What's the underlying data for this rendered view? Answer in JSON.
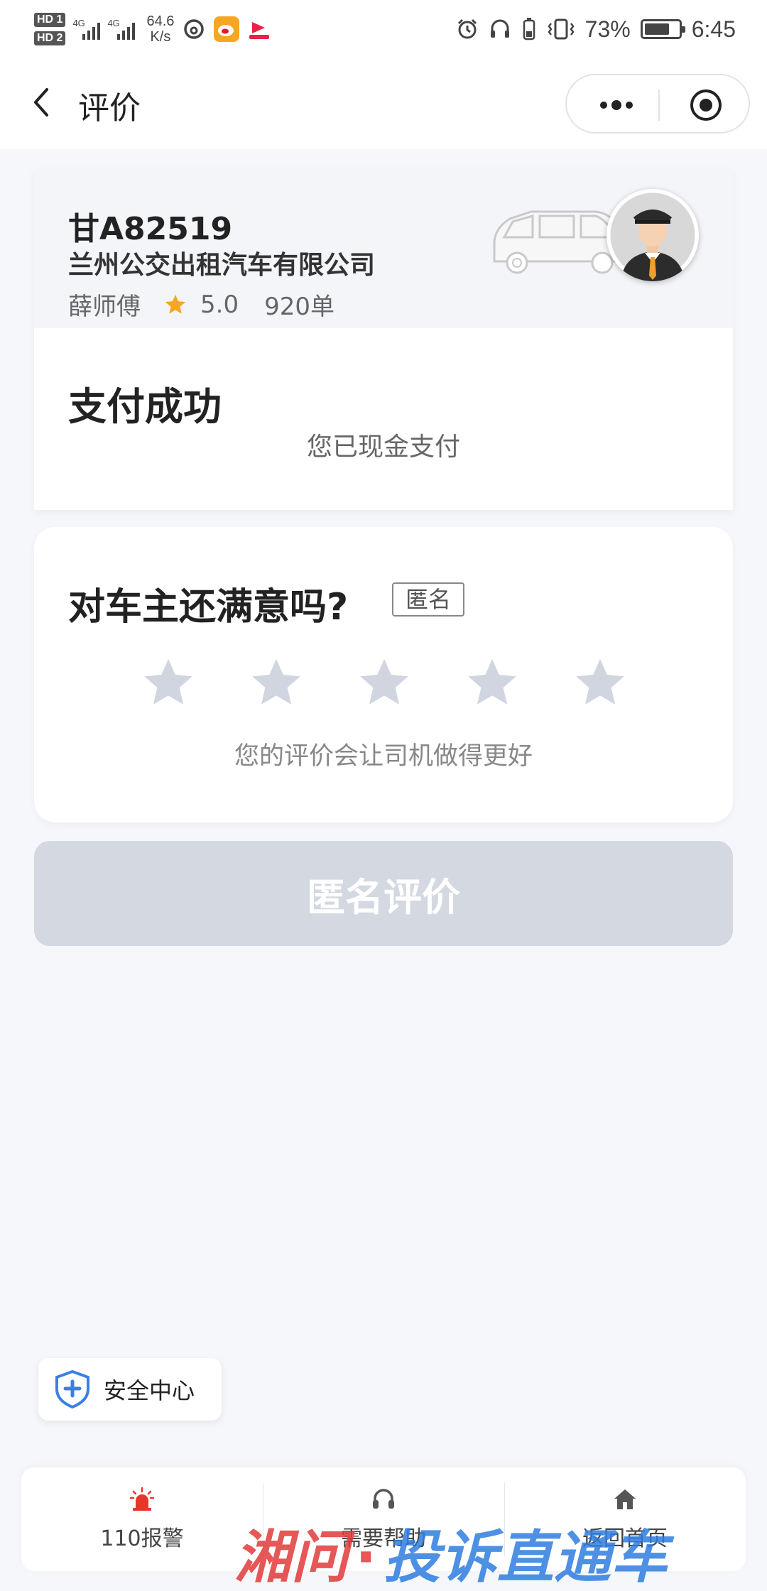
{
  "status_bar": {
    "hd_badges": [
      "HD 1",
      "HD 2"
    ],
    "network_1": "4G",
    "network_2": "4G",
    "speed_value": "64.6",
    "speed_unit": "K/s",
    "battery_text": "73%",
    "battery_level": 0.73,
    "time": "6:45"
  },
  "header": {
    "title": "评价"
  },
  "trip": {
    "plate": "甘A82519",
    "company": "兰州公交出租汽车有限公司",
    "driver_name": "薛师傅",
    "rating": "5.0",
    "orders": "920单",
    "payment_title": "支付成功",
    "payment_desc": "您已现金支付"
  },
  "rating": {
    "question": "对车主还满意吗?",
    "anonymous_tag": "匿名",
    "stars_total": 5,
    "stars_selected": 0,
    "hint": "您的评价会让司机做得更好"
  },
  "submit": {
    "label": "匿名评价"
  },
  "safety": {
    "label": "安全中心"
  },
  "bottom_actions": [
    {
      "label": "110报警",
      "icon": "alarm-icon"
    },
    {
      "label": "需要帮助",
      "icon": "headset-icon"
    },
    {
      "label": "返回首页",
      "icon": "home-icon"
    }
  ],
  "watermark": {
    "text": "湘问·投诉直通车"
  },
  "colors": {
    "star_filled": "#f5a623",
    "star_empty": "#d0d5df",
    "button_disabled": "#d3d8e1",
    "alarm_red": "#e8352b",
    "shield_blue": "#3b7fe6",
    "watermark_red": "#e23a3a",
    "watermark_blue": "#2e7de0"
  }
}
